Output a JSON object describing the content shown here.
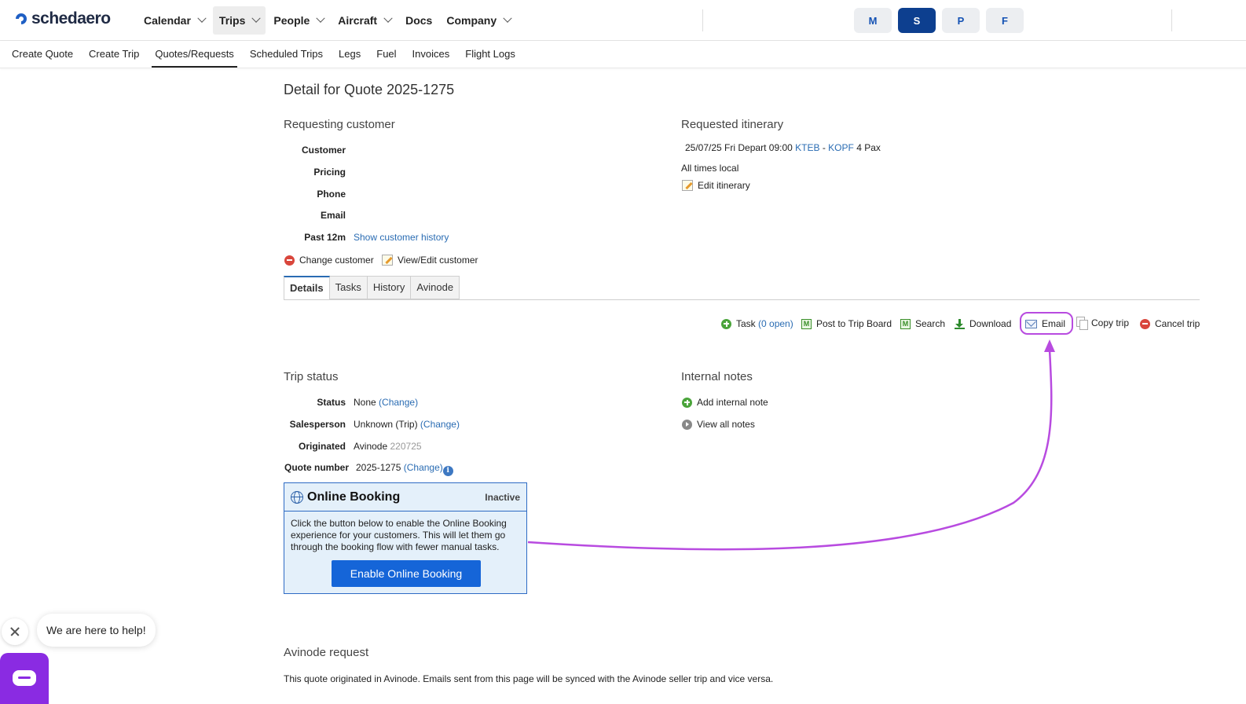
{
  "brand": {
    "name": "schedaero"
  },
  "nav": {
    "items": [
      {
        "label": "Calendar",
        "has_menu": true
      },
      {
        "label": "Trips",
        "has_menu": true,
        "active": true
      },
      {
        "label": "People",
        "has_menu": true
      },
      {
        "label": "Aircraft",
        "has_menu": true
      },
      {
        "label": "Docs",
        "has_menu": false
      },
      {
        "label": "Company",
        "has_menu": true
      }
    ],
    "mode_buttons": [
      {
        "label": "M"
      },
      {
        "label": "S",
        "active": true
      },
      {
        "label": "P"
      },
      {
        "label": "F"
      }
    ]
  },
  "subnav": {
    "items": [
      "Create Quote",
      "Create Trip",
      "Quotes/Requests",
      "Scheduled Trips",
      "Legs",
      "Fuel",
      "Invoices",
      "Flight Logs"
    ],
    "active_index": 2
  },
  "page": {
    "title": "Detail for Quote 2025-1275"
  },
  "customer": {
    "heading": "Requesting customer",
    "labels": {
      "customer": "Customer",
      "pricing": "Pricing",
      "phone": "Phone",
      "email": "Email",
      "past": "Past 12m"
    },
    "show_history": "Show customer history",
    "change_customer": "Change customer",
    "view_edit_customer": "View/Edit customer"
  },
  "itinerary": {
    "heading": "Requested itinerary",
    "leg": {
      "date": "25/07/25 Fri",
      "depart": "Depart",
      "time": "09:00",
      "from": "KTEB",
      "sep": "-",
      "to": "KOPF",
      "pax": "4 Pax"
    },
    "times_note": "All times local",
    "edit": "Edit itinerary"
  },
  "tabs": [
    "Details",
    "Tasks",
    "History",
    "Avinode"
  ],
  "actions": {
    "task": "Task",
    "task_count": "(0 open)",
    "post": "Post to Trip Board",
    "search": "Search",
    "download": "Download",
    "email": "Email",
    "copy": "Copy trip",
    "cancel": "Cancel trip",
    "m_glyph": "M"
  },
  "trip_status": {
    "heading": "Trip status",
    "labels": {
      "status": "Status",
      "salesperson": "Salesperson",
      "originated": "Originated",
      "quote_number": "Quote number"
    },
    "status_value": "None",
    "salesperson_value": "Unknown (Trip)",
    "originated_value": "Avinode",
    "originated_id": "220725",
    "quote_number_value": "2025-1275",
    "change": "(Change)",
    "info_glyph": "i"
  },
  "notes": {
    "heading": "Internal notes",
    "add": "Add internal note",
    "view_all": "View all notes"
  },
  "online_booking": {
    "title": "Online Booking",
    "status": "Inactive",
    "text": "Click the button below to enable the Online Booking experience for your customers. This will let them go through the booking flow with fewer manual tasks.",
    "button": "Enable Online Booking"
  },
  "avinode": {
    "heading": "Avinode request",
    "text": "This quote originated in Avinode. Emails sent from this page will be synced with the Avinode seller trip and vice versa."
  },
  "help": {
    "bubble": "We are here to help!"
  },
  "colors": {
    "accent": "#2a6cb3",
    "annotation": "#b84be0",
    "primary_button": "#1565d8",
    "chat": "#8a2be2"
  }
}
